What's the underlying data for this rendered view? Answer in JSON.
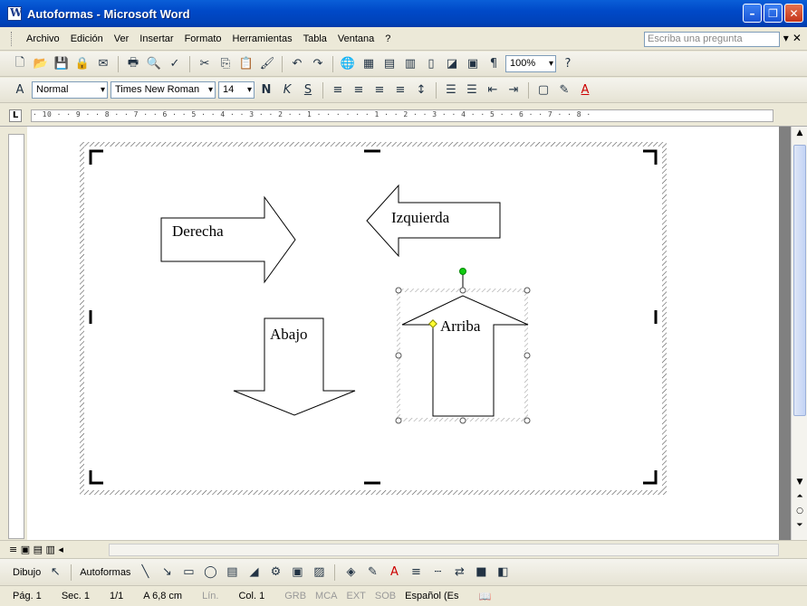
{
  "window": {
    "title": "Autoformas - Microsoft Word"
  },
  "menu": {
    "items": [
      "Archivo",
      "Edición",
      "Ver",
      "Insertar",
      "Formato",
      "Herramientas",
      "Tabla",
      "Ventana",
      "?"
    ],
    "ask_placeholder": "Escriba una pregunta"
  },
  "toolbar": {
    "zoom": "100%",
    "style": "Normal",
    "font": "Times New Roman",
    "size": "14",
    "bold": "N",
    "italic": "K",
    "underline": "S"
  },
  "ruler": {
    "marks": "· 10 · · 9 · · 8 · · 7 · · 6 · · 5 · · 4 · · 3 · · 2 · · 1 · · · · · · 1 · · 2 · · 3 · · 4 · · 5 · · 6 · · 7 · · 8 ·"
  },
  "canvas": {
    "shapes": {
      "right": "Derecha",
      "left": "Izquierda",
      "down": "Abajo",
      "up": "Arriba"
    }
  },
  "drawbar": {
    "draw": "Dibujo",
    "autoshapes": "Autoformas"
  },
  "status": {
    "page": "Pág. 1",
    "section": "Sec. 1",
    "pages": "1/1",
    "at": "A 6,8 cm",
    "line": "Lín.",
    "col": "Col. 1",
    "rec": "GRB",
    "trk": "MCA",
    "ext": "EXT",
    "ovr": "SOB",
    "lang": "Español (Es"
  }
}
